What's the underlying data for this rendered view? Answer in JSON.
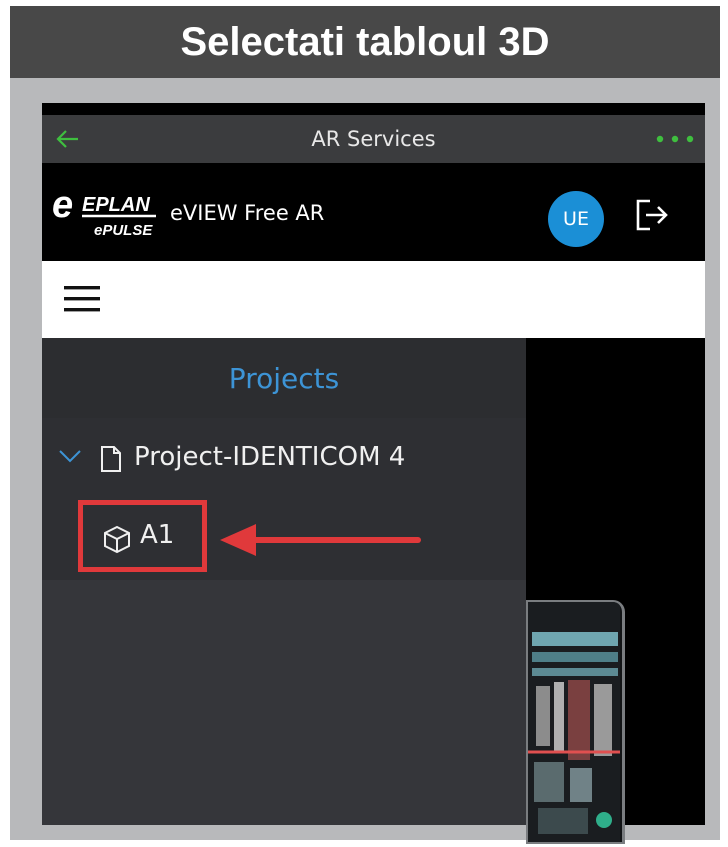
{
  "slide": {
    "title": "Selectati tabloul 3D"
  },
  "app": {
    "header_title": "AR Services",
    "brand_logo_text": "EPLAN",
    "brand_logo_sub": "ePULSE",
    "app_name": "eVIEW Free AR",
    "user_initials": "UE"
  },
  "sidebar": {
    "heading": "Projects",
    "project": {
      "label": "Project-IDENTICOM 4",
      "expanded": true,
      "children": [
        {
          "label": "A1",
          "icon": "cube-icon"
        }
      ]
    }
  },
  "icons": {
    "back": "back-arrow-icon",
    "more": "more-dots-icon",
    "logout": "logout-icon",
    "menu": "hamburger-menu-icon",
    "expand": "chevron-down-icon",
    "document": "file-icon",
    "model": "cube-icon"
  },
  "colors": {
    "title_bar": "#484848",
    "header": "#3b3c3e",
    "accent_green": "#3fbf3f",
    "avatar_blue": "#1b8fd6",
    "projects_blue": "#3d94d6",
    "highlight_red": "#e0393b"
  }
}
